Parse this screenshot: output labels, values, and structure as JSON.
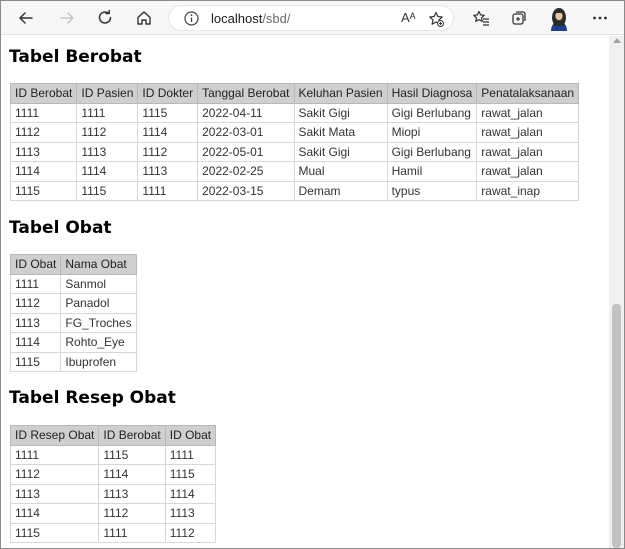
{
  "browser": {
    "url_host": "localhost",
    "url_path": "/sbd/",
    "read_aloud_label": "Aᴬ"
  },
  "tables": [
    {
      "title": "Tabel Berobat",
      "columns": [
        "ID Berobat",
        "ID Pasien",
        "ID Dokter",
        "Tanggal Berobat",
        "Keluhan Pasien",
        "Hasil Diagnosa",
        "Penatalaksanaan"
      ],
      "rows": [
        [
          "1111",
          "1111",
          "1115",
          "2022-04-11",
          "Sakit Gigi",
          "Gigi Berlubang",
          "rawat_jalan"
        ],
        [
          "1112",
          "1112",
          "1114",
          "2022-03-01",
          "Sakit Mata",
          "Miopi",
          "rawat_jalan"
        ],
        [
          "1113",
          "1113",
          "1112",
          "2022-05-01",
          "Sakit Gigi",
          "Gigi Berlubang",
          "rawat_jalan"
        ],
        [
          "1114",
          "1114",
          "1113",
          "2022-02-25",
          "Mual",
          "Hamil",
          "rawat_jalan"
        ],
        [
          "1115",
          "1115",
          "1111",
          "2022-03-15",
          "Demam",
          "typus",
          "rawat_inap"
        ]
      ]
    },
    {
      "title": "Tabel Obat",
      "columns": [
        "ID Obat",
        "Nama Obat"
      ],
      "rows": [
        [
          "1111",
          "Sanmol"
        ],
        [
          "1112",
          "Panadol"
        ],
        [
          "1113",
          "FG_Troches"
        ],
        [
          "1114",
          "Rohto_Eye"
        ],
        [
          "1115",
          "Ibuprofen"
        ]
      ]
    },
    {
      "title": "Tabel Resep Obat",
      "columns": [
        "ID Resep Obat",
        "ID Berobat",
        "ID Obat"
      ],
      "rows": [
        [
          "1111",
          "1115",
          "1111"
        ],
        [
          "1112",
          "1114",
          "1115"
        ],
        [
          "1113",
          "1113",
          "1114"
        ],
        [
          "1114",
          "1112",
          "1113"
        ],
        [
          "1115",
          "1111",
          "1112"
        ]
      ]
    }
  ]
}
